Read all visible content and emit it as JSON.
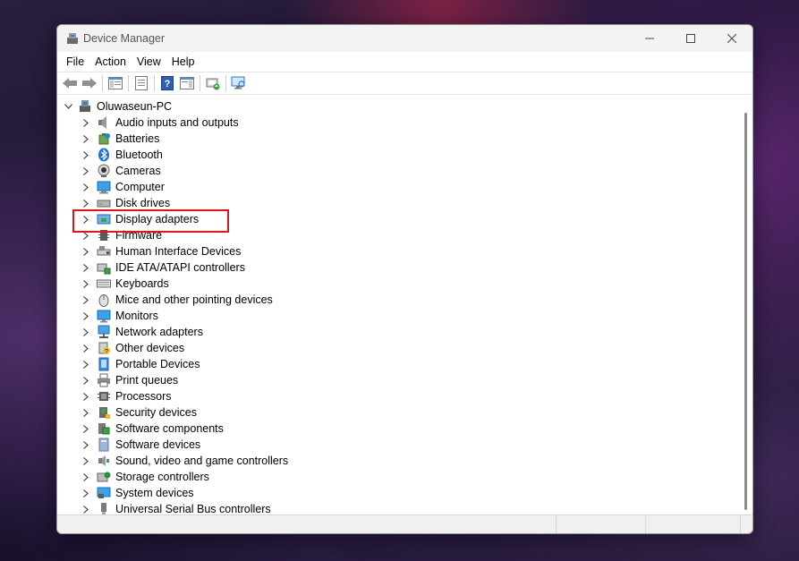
{
  "window": {
    "title": "Device Manager"
  },
  "menu": [
    "File",
    "Action",
    "View",
    "Help"
  ],
  "tree": {
    "root": "Oluwaseun-PC",
    "items": [
      {
        "label": "Audio inputs and outputs",
        "icon": "speaker-icon"
      },
      {
        "label": "Batteries",
        "icon": "battery-icon"
      },
      {
        "label": "Bluetooth",
        "icon": "bluetooth-icon"
      },
      {
        "label": "Cameras",
        "icon": "camera-icon"
      },
      {
        "label": "Computer",
        "icon": "computer-icon"
      },
      {
        "label": "Disk drives",
        "icon": "disk-drive-icon"
      },
      {
        "label": "Display adapters",
        "icon": "display-adapter-icon"
      },
      {
        "label": "Firmware",
        "icon": "firmware-icon"
      },
      {
        "label": "Human Interface Devices",
        "icon": "hid-icon"
      },
      {
        "label": "IDE ATA/ATAPI controllers",
        "icon": "ide-controller-icon"
      },
      {
        "label": "Keyboards",
        "icon": "keyboard-icon"
      },
      {
        "label": "Mice and other pointing devices",
        "icon": "mouse-icon"
      },
      {
        "label": "Monitors",
        "icon": "monitor-icon"
      },
      {
        "label": "Network adapters",
        "icon": "network-adapter-icon"
      },
      {
        "label": "Other devices",
        "icon": "other-devices-icon"
      },
      {
        "label": "Portable Devices",
        "icon": "portable-device-icon"
      },
      {
        "label": "Print queues",
        "icon": "printer-icon"
      },
      {
        "label": "Processors",
        "icon": "processor-icon"
      },
      {
        "label": "Security devices",
        "icon": "security-device-icon"
      },
      {
        "label": "Software components",
        "icon": "software-component-icon"
      },
      {
        "label": "Software devices",
        "icon": "software-device-icon"
      },
      {
        "label": "Sound, video and game controllers",
        "icon": "sound-controller-icon"
      },
      {
        "label": "Storage controllers",
        "icon": "storage-controller-icon"
      },
      {
        "label": "System devices",
        "icon": "system-devices-icon"
      },
      {
        "label": "Universal Serial Bus controllers",
        "icon": "usb-icon"
      }
    ]
  },
  "highlighted_item": "Display adapters",
  "colors": {
    "highlight_border": "#e0141e",
    "accent_blue": "#1e73d6"
  }
}
